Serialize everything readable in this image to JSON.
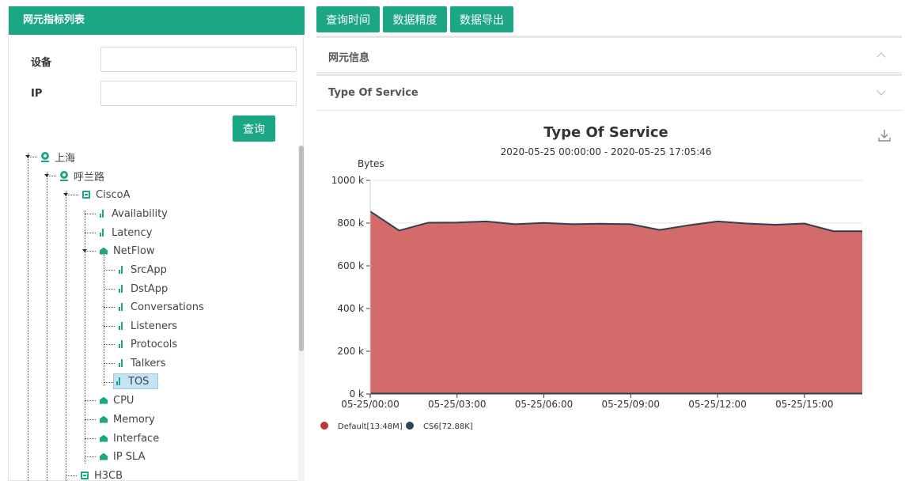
{
  "left_panel": {
    "title": "网元指标列表",
    "device_label": "设备",
    "device_value": "",
    "ip_label": "IP",
    "ip_value": "",
    "query_button": "查询",
    "tree": {
      "shanghai": "上海",
      "hulan_road": "呼兰路",
      "cisco_a": "CiscoA",
      "availability": "Availability",
      "latency": "Latency",
      "netflow": "NetFlow",
      "src_app": "SrcApp",
      "dst_app": "DstApp",
      "conversations": "Conversations",
      "listeners": "Listeners",
      "protocols": "Protocols",
      "talkers": "Talkers",
      "tos": "TOS",
      "cpu": "CPU",
      "memory": "Memory",
      "interface": "Interface",
      "ip_sla": "IP SLA",
      "h3cb": "H3CB"
    }
  },
  "toolbar": {
    "query_time": "查询时间",
    "data_precision": "数据精度",
    "data_export": "数据导出"
  },
  "sections": {
    "ne_info": "网元信息",
    "tos": "Type Of Service"
  },
  "colors": {
    "accent": "#1ba784",
    "area_fill": "#d26b69",
    "line": "#2f3f4f",
    "legend_default": "#c23531",
    "legend_cs6": "#2f4554"
  },
  "chart_data": {
    "type": "area",
    "title": "Type Of Service",
    "subtitle": "2020-05-25 00:00:00 - 2020-05-25 17:05:46",
    "ylabel": "Bytes",
    "ylim": [
      0,
      1000000
    ],
    "yticks": [
      "0 k",
      "200 k",
      "400 k",
      "600 k",
      "800 k",
      "1000 k"
    ],
    "xtick_labels": [
      "05-25/00:00",
      "05-25/03:00",
      "05-25/06:00",
      "05-25/09:00",
      "05-25/12:00",
      "05-25/15:00"
    ],
    "x_hours": [
      0,
      1,
      2,
      3,
      4,
      5,
      6,
      7,
      8,
      9,
      10,
      11,
      12,
      13,
      14,
      15,
      16,
      17
    ],
    "series": [
      {
        "name": "Default[13.48M]",
        "values": [
          855000,
          765000,
          802000,
          803000,
          808000,
          795000,
          801000,
          795000,
          797000,
          795000,
          768000,
          790000,
          808000,
          798000,
          792000,
          798000,
          762000,
          762000
        ]
      },
      {
        "name": "CS6[72.88K]",
        "values": [
          4000,
          4000,
          4000,
          4000,
          4000,
          4000,
          4000,
          4000,
          4000,
          4000,
          4000,
          4000,
          4000,
          4000,
          4000,
          4000,
          4000,
          4000
        ]
      }
    ],
    "grid": true,
    "legend_position": "bottom-left"
  }
}
